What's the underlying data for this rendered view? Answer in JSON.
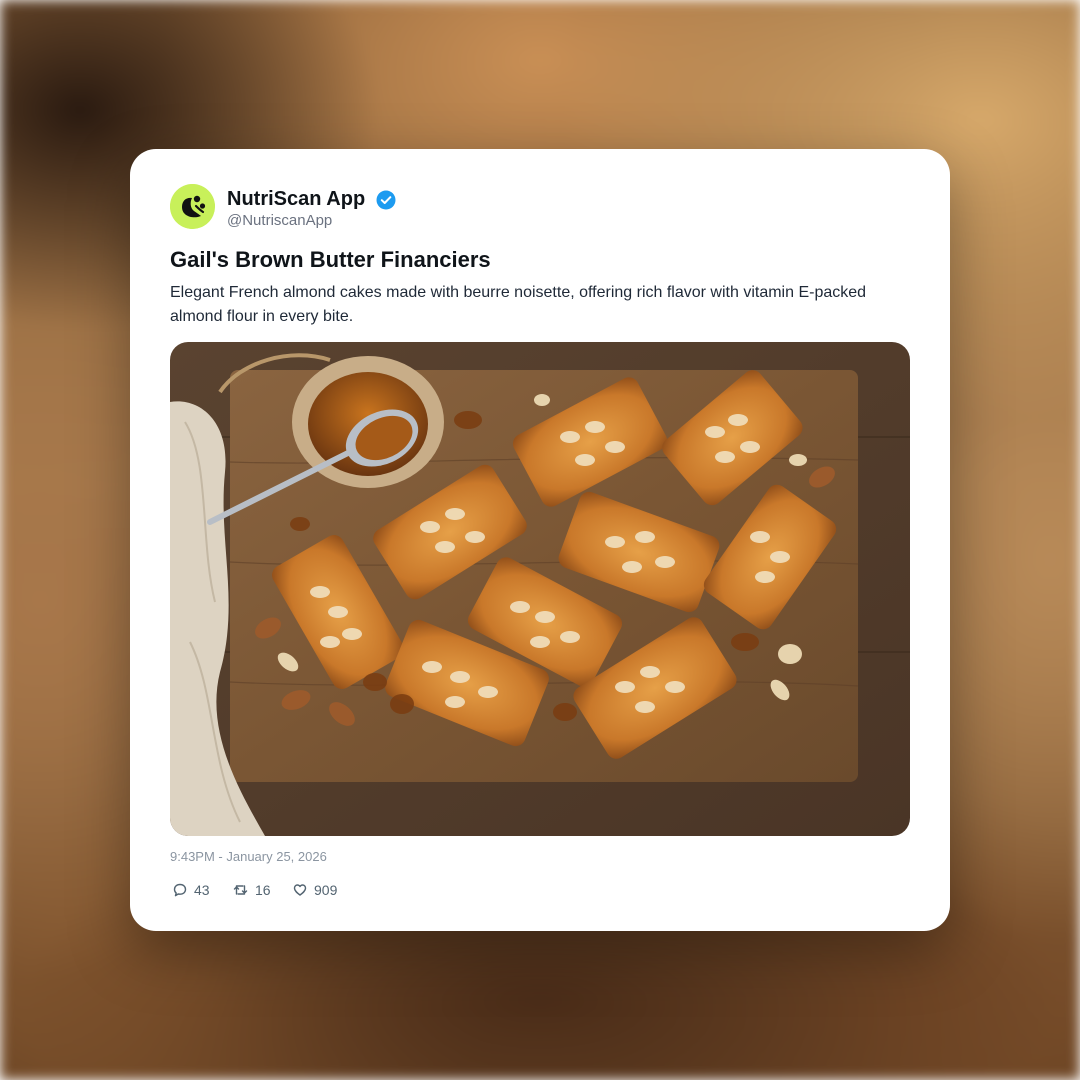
{
  "post": {
    "author": {
      "name": "NutriScan App",
      "handle": "@NutriscanApp",
      "verified": true,
      "avatar_icon": "leaf-logo-icon"
    },
    "title": "Gail's Brown Butter Financiers",
    "description": "Elegant French almond cakes made with beurre noisette, offering rich flavor with vitamin E-packed almond flour in every bite.",
    "image_icon": "financiers-photo",
    "timestamp": "9:43PM - January 25, 2026",
    "stats": {
      "replies": "43",
      "reposts": "16",
      "likes": "909"
    }
  },
  "colors": {
    "avatar_bg": "#c8f05a",
    "verified_badge": "#1d9bf0",
    "text_primary": "#0f1419",
    "text_secondary": "#536471"
  }
}
